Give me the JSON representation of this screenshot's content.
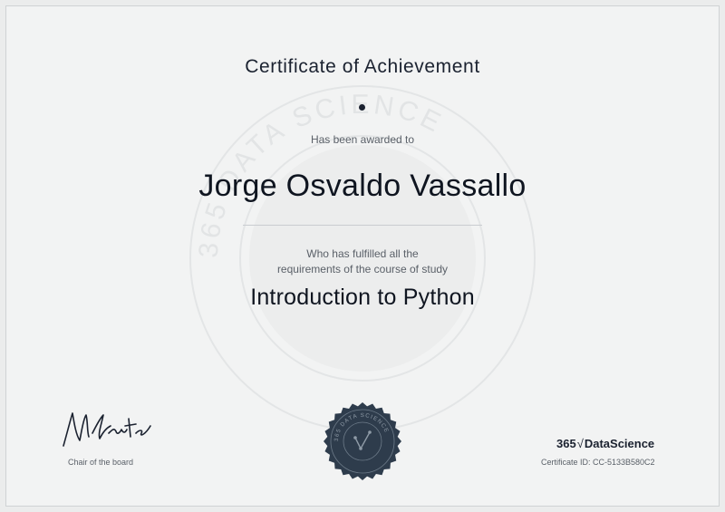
{
  "certificate": {
    "title": "Certificate of Achievement",
    "awarded_text": "Has been awarded to",
    "recipient_name": "Jorge Osvaldo Vassallo",
    "fulfilled_line1": "Who has fulfilled all the",
    "fulfilled_line2": "requirements of the course of study",
    "course_name": "Introduction to Python",
    "signer_role": "Chair of the board",
    "brand_number": "365",
    "brand_symbol": "√",
    "brand_name": "DataScience",
    "certificate_id": "Certificate ID: CC-5133B580C2",
    "watermark_text": "365 DATA SCIENCE",
    "seal_text": "365 DATA SCIENCE"
  },
  "colors": {
    "ink": "#1b2230",
    "muted": "#5a6068",
    "seal": "#2e3c4c",
    "paper": "#f2f3f3"
  }
}
